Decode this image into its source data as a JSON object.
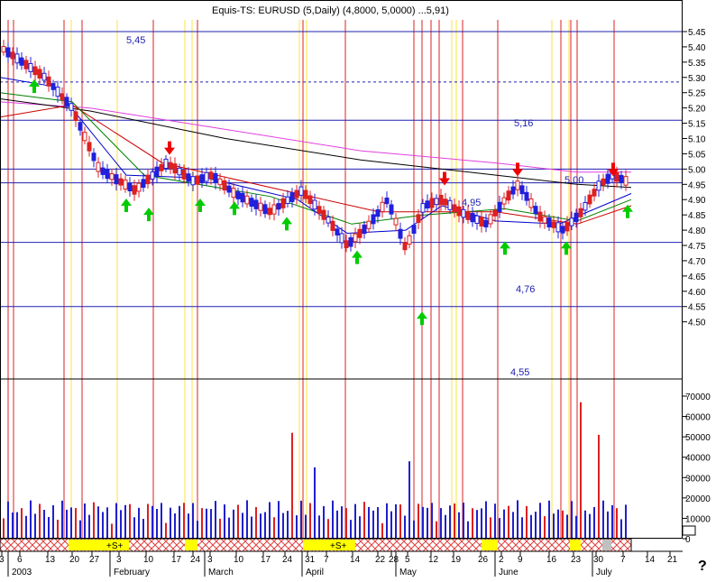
{
  "header": {
    "title": "Equis-TS: EURUSD (5,Daily) (4,8000, 5,0000) ...5,91)"
  },
  "help_label": "?",
  "chart_data": {
    "type": "candlestick",
    "price_axis": {
      "range": [
        4.45,
        5.51
      ],
      "ticks": [
        "5.45",
        "5.40",
        "5.35",
        "5.30",
        "5.25",
        "5.20",
        "5.15",
        "5.10",
        "5.05",
        "5.00",
        "4.95",
        "4.90",
        "4.85",
        "4.80",
        "4.75",
        "4.70",
        "4.65",
        "4.60",
        "4.55",
        "4.50"
      ]
    },
    "volume_axis": {
      "max": 75000,
      "ticks": [
        "70000",
        "60000",
        "50000",
        "40000",
        "30000",
        "20000",
        "10000",
        "0"
      ]
    },
    "date_axis": {
      "day_labels": [
        "3",
        "6",
        "13",
        "20",
        "27",
        "3",
        "10",
        "17",
        "24",
        "3",
        "10",
        "17",
        "24",
        "31",
        "7",
        "14",
        "22",
        "28",
        "5",
        "12",
        "19",
        "26",
        "2",
        "9",
        "16",
        "23",
        "30",
        "7",
        "14",
        "21"
      ],
      "month_labels": [
        "2003",
        "February",
        "March",
        "April",
        "May",
        "June",
        "July"
      ]
    },
    "levels": [
      {
        "label": "5,45",
        "value": 5.45,
        "style": "solid"
      },
      {
        "label": "",
        "value": 5.285,
        "style": "dashed"
      },
      {
        "label": "5,16",
        "value": 5.16,
        "style": "solid"
      },
      {
        "label": "5,00",
        "value": 5.0,
        "style": "solid"
      },
      {
        "label": "4,95",
        "value": 4.955,
        "style": "solid"
      },
      {
        "label": "4,76",
        "value": 4.76,
        "style": "solid"
      },
      {
        "label": "4,55",
        "value": 4.55,
        "style": "solid"
      }
    ],
    "strip_labels": [
      "+S+",
      "+S+"
    ],
    "ma_colors": {
      "red": "#cc0000",
      "green": "#008000",
      "blue": "#0000cc",
      "black": "#000000",
      "magenta": "#e040e0"
    }
  }
}
